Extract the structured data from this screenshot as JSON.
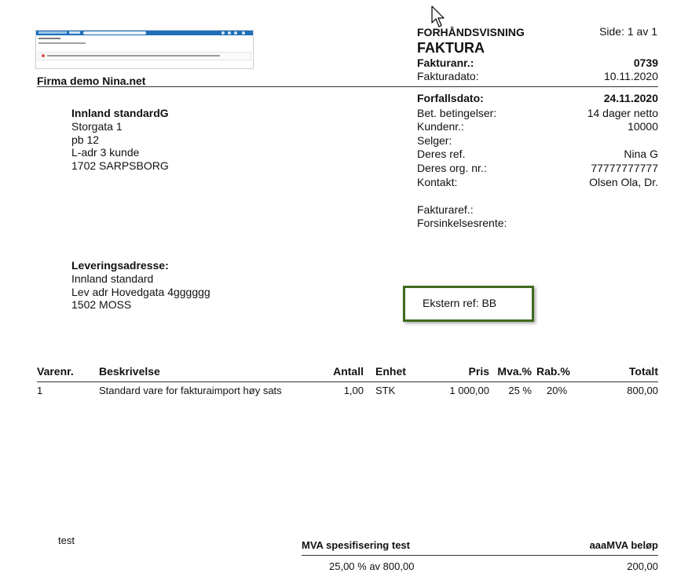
{
  "header": {
    "preview_label": "FORHÅNDSVISNING",
    "doc_title": "FAKTURA",
    "page_info": "Side: 1 av 1",
    "invoice_no_label": "Fakturanr.:",
    "invoice_no": "0739",
    "invoice_date_label": "Fakturadato:",
    "invoice_date": "10.11.2020",
    "due_date_label": "Forfallsdato:",
    "due_date": "24.11.2020"
  },
  "company": {
    "name": "Firma demo Nina.net"
  },
  "customer": {
    "name": "Innland standardG",
    "lines": [
      "Storgata 1",
      "pb 12",
      "L-adr 3 kunde",
      "1702 SARPSBORG"
    ]
  },
  "terms": [
    {
      "label": "Bet. betingelser:",
      "value": "14 dager netto"
    },
    {
      "label": "Kundenr.:",
      "value": "10000"
    },
    {
      "label": "Selger:",
      "value": ""
    },
    {
      "label": "Deres ref.",
      "value": "Nina G"
    },
    {
      "label": "Deres org. nr.:",
      "value": "77777777777"
    },
    {
      "label": "Kontakt:",
      "value": "Olsen Ola, Dr."
    }
  ],
  "refs": {
    "invoice_ref_label": "Fakturaref.:",
    "late_interest_label": "Forsinkelsesrente:"
  },
  "delivery": {
    "label": "Leveringsadresse:",
    "lines": [
      "Innland standard",
      "Lev adr Hovedgata 4gggggg",
      "1502 MOSS"
    ]
  },
  "external_ref": "Ekstern ref: BB",
  "table": {
    "headers": [
      "Varenr.",
      "Beskrivelse",
      "Antall",
      "Enhet",
      "Pris",
      "Mva.%",
      "Rab.%",
      "Totalt"
    ],
    "rows": [
      [
        "1",
        "Standard vare for fakturaimport høy sats",
        "1,00",
        "STK",
        "1 000,00",
        "25 %",
        "20%",
        "800,00"
      ]
    ]
  },
  "footer": {
    "note": "test",
    "vat_spec_label": "MVA spesifisering test",
    "vat_amount_label": "aaaMVA beløp",
    "vat_line": "25,00 % av  800,00",
    "vat_amount": "200,00"
  },
  "colors": {
    "highlight_border": "#3f6a1e"
  }
}
